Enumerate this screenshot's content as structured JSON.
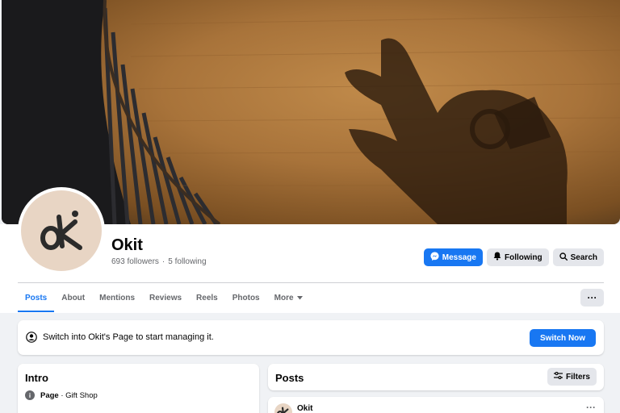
{
  "page": {
    "name": "Okit",
    "followers": "693 followers",
    "separator": "·",
    "following": "5 following"
  },
  "actions": {
    "message": "Message",
    "following": "Following",
    "search": "Search"
  },
  "tabs": [
    "Posts",
    "About",
    "Mentions",
    "Reviews",
    "Reels",
    "Photos",
    "More"
  ],
  "more_menu": "···",
  "banner": {
    "text": "Switch into Okit's Page to start managing it.",
    "button": "Switch Now"
  },
  "intro": {
    "title": "Intro",
    "category_label": "Page",
    "category_value": " · Gift Shop"
  },
  "posts": {
    "title": "Posts",
    "filters": "Filters",
    "first_post_author": "Okit",
    "post_menu": "···"
  },
  "colors": {
    "accent": "#1877f2",
    "background": "#f0f2f5",
    "avatar_bg": "#e8d5c4"
  }
}
